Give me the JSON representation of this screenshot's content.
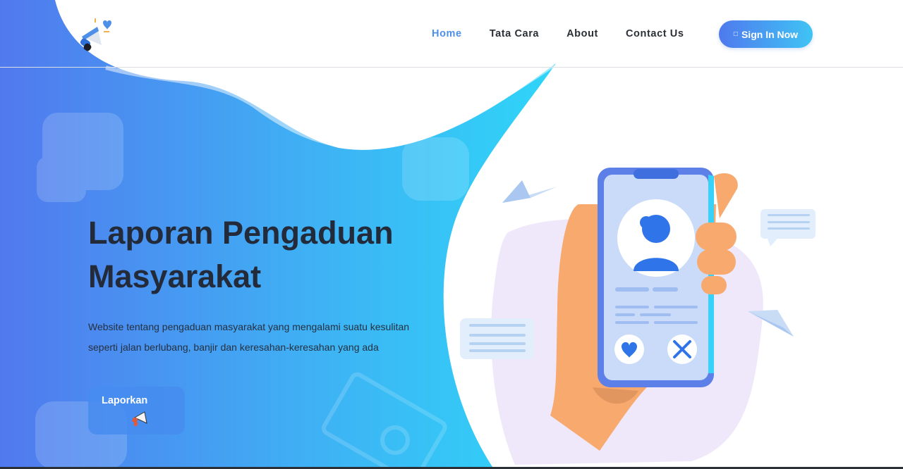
{
  "header": {
    "nav": [
      {
        "label": "Home",
        "active": true
      },
      {
        "label": "Tata Cara",
        "active": false
      },
      {
        "label": "About",
        "active": false
      },
      {
        "label": "Contact Us",
        "active": false
      }
    ],
    "signin_label": "Sign In Now",
    "signin_icon": "lock-icon"
  },
  "hero": {
    "title_line1": "Laporan Pengaduan",
    "title_line2": "Masyarakat",
    "desc_line1": "Website tentang pengaduan masyarakat yang mengalami suatu kesulitan",
    "desc_line2": "seperti jalan berlubang, banjir dan keresahan-keresahan yang ada",
    "button_label": "Laporkan",
    "button_icon": "megaphone-icon"
  },
  "colors": {
    "gradient_start": "#5179ee",
    "gradient_end": "#2fd1f7",
    "nav_active": "#4e8fe8",
    "title": "#232b3a"
  }
}
